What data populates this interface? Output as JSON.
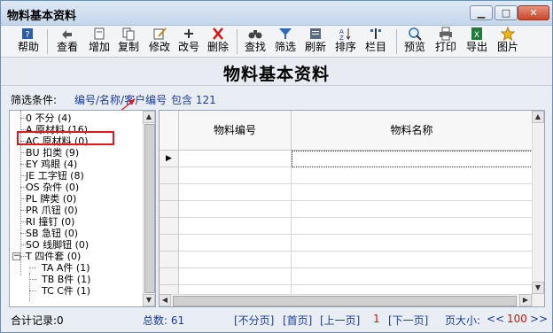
{
  "window": {
    "title": "物料基本资料",
    "minimize": "▁",
    "maximize": "□",
    "close": "✕"
  },
  "toolbar": [
    {
      "name": "help-button",
      "label": "帮助",
      "icon": "help-icon"
    },
    {
      "name": "view-button",
      "label": "查看",
      "icon": "view-icon"
    },
    {
      "name": "add-button",
      "label": "增加",
      "icon": "add-icon"
    },
    {
      "name": "copy-button",
      "label": "复制",
      "icon": "copy-icon"
    },
    {
      "name": "edit-button",
      "label": "修改",
      "icon": "edit-icon"
    },
    {
      "name": "rename-code-button",
      "label": "改号",
      "icon": "plus-icon"
    },
    {
      "name": "delete-button",
      "label": "删除",
      "icon": "delete-icon"
    },
    {
      "name": "find-button",
      "label": "查找",
      "icon": "binoculars-icon"
    },
    {
      "name": "filter-button",
      "label": "筛选",
      "icon": "funnel-icon"
    },
    {
      "name": "refresh-button",
      "label": "刷新",
      "icon": "refresh-icon"
    },
    {
      "name": "sort-button",
      "label": "排序",
      "icon": "sort-icon"
    },
    {
      "name": "columns-button",
      "label": "栏目",
      "icon": "columns-icon"
    },
    {
      "name": "preview-button",
      "label": "预览",
      "icon": "magnifier-icon"
    },
    {
      "name": "print-button",
      "label": "打印",
      "icon": "printer-icon"
    },
    {
      "name": "export-button",
      "label": "导出",
      "icon": "excel-icon"
    },
    {
      "name": "picture-button",
      "label": "图片",
      "icon": "star-icon"
    }
  ],
  "header": {
    "title": "物料基本资料"
  },
  "filter": {
    "label": "筛选条件:",
    "value": "编号/名称/客户编号",
    "count": "包含 121"
  },
  "tree": [
    {
      "label": "0 不分 (4)",
      "level": 1
    },
    {
      "label": "A 原材料 (16)",
      "level": 1
    },
    {
      "label": "AC 原材料 (0)",
      "level": 1
    },
    {
      "label": "BU 扣类 (9)",
      "level": 1
    },
    {
      "label": "EY 鸡眼 (4)",
      "level": 1
    },
    {
      "label": "JE 工字钮 (8)",
      "level": 1
    },
    {
      "label": "OS 杂件 (0)",
      "level": 1
    },
    {
      "label": "PL 牌类 (0)",
      "level": 1
    },
    {
      "label": "PR 爪钮 (0)",
      "level": 1
    },
    {
      "label": "RI 撞钉 (0)",
      "level": 1
    },
    {
      "label": "SB 急钮 (0)",
      "level": 1
    },
    {
      "label": "SO 线脚钮 (0)",
      "level": 1
    },
    {
      "label": "T 四件套 (0)",
      "level": 1,
      "expander": "−"
    },
    {
      "label": "TA A件 (1)",
      "level": 2
    },
    {
      "label": "TB B件 (1)",
      "level": 2
    },
    {
      "label": "TC C件 (1)",
      "level": 2
    }
  ],
  "grid": {
    "columns": [
      "物料编号",
      "物料名称"
    ],
    "row_marker": "▶"
  },
  "status": {
    "total_label": "合计记录:0",
    "count_label": "总数: 61",
    "no_page": "[不分页]",
    "first": "[首页]",
    "prev": "[上一页]",
    "page": "1",
    "next": "[下一页]",
    "page_size_label": "页大小:",
    "prev_size": "<<",
    "page_size": "100",
    "next_size": ">>"
  },
  "colors": {
    "highlight": "#e01a1a",
    "link": "#1a3c9b"
  }
}
